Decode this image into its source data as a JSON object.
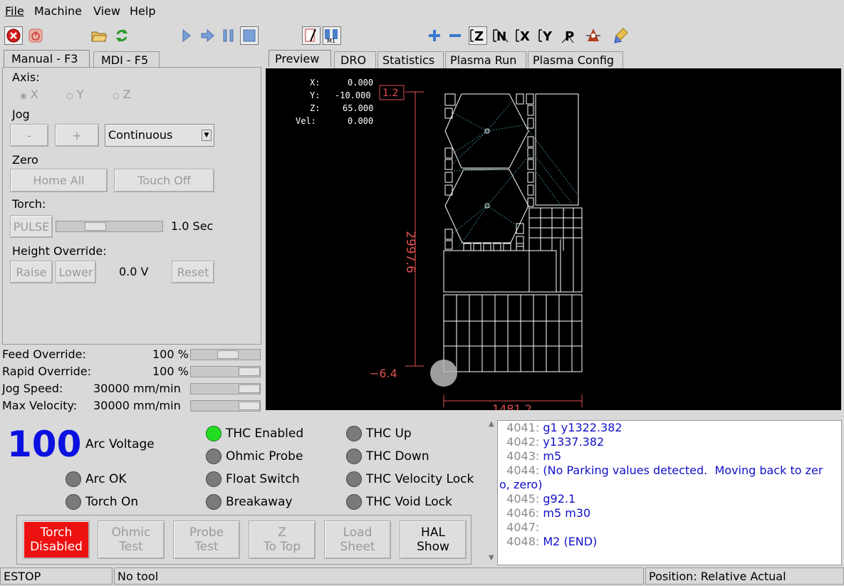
{
  "menu": {
    "file": "File",
    "machine": "Machine",
    "view": "View",
    "help": "Help"
  },
  "toolbar": {
    "estop": "estop-icon",
    "power": "power-icon",
    "open": "open-folder-icon",
    "reload": "reload-icon",
    "run": "run-icon",
    "step": "step-icon",
    "pause": "pause-icon",
    "stop": "stop-icon",
    "plus": "zoom-in-icon",
    "minus": "zoom-out-icon",
    "view_z": "Z",
    "view_z2": "N",
    "view_x": "X",
    "view_y": "Y",
    "view_p": "P"
  },
  "left_tabs": {
    "manual": "Manual - F3",
    "mdi": "MDI - F5"
  },
  "right_tabs": {
    "preview": "Preview",
    "dro": "DRO",
    "statistics": "Statistics",
    "plasma_run": "Plasma Run",
    "plasma_config": "Plasma Config"
  },
  "manual": {
    "axis_label": "Axis:",
    "axis_x": "X",
    "axis_y": "Y",
    "axis_z": "Z",
    "jog_label": "Jog",
    "jog_minus": "-",
    "jog_plus": "+",
    "jog_mode": "Continuous",
    "zero_label": "Zero",
    "home_all": "Home All",
    "touch_off": "Touch Off",
    "torch_label": "Torch:",
    "pulse": "PULSE",
    "pulse_time": "1.0 Sec",
    "height_label": "Height Override:",
    "raise": "Raise",
    "lower": "Lower",
    "height_value": "0.0 V",
    "reset": "Reset"
  },
  "overrides": {
    "feed_label": "Feed Override:",
    "feed_value": "100 %",
    "feed_fraction": 0.55,
    "rapid_label": "Rapid Override:",
    "rapid_value": "100 %",
    "rapid_fraction": 1.0,
    "jog_label": "Jog Speed:",
    "jog_value": "30000 mm/min",
    "jog_fraction": 1.0,
    "maxvel_label": "Max Velocity:",
    "maxvel_value": "30000 mm/min",
    "maxvel_fraction": 1.0
  },
  "preview": {
    "dro_x_label": "X:",
    "dro_x": "0.000",
    "dro_y_label": "Y:",
    "dro_y": "-10.000",
    "dro_z_label": "Z:",
    "dro_z": "65.000",
    "dro_vel_label": "Vel:",
    "dro_vel": "0.000",
    "dim_height": "2997.6",
    "dim_width": "1481.2",
    "dim_origin": "−6.4",
    "dim_top": "1.2",
    "dim_color": "#e05050"
  },
  "plasma": {
    "arc_voltage_value": "100",
    "arc_voltage_label": "Arc Voltage",
    "arc_ok": "Arc OK",
    "torch_on": "Torch On",
    "thc_enabled": "THC Enabled",
    "ohmic_probe": "Ohmic Probe",
    "float_switch": "Float Switch",
    "breakaway": "Breakaway",
    "thc_up": "THC Up",
    "thc_down": "THC Down",
    "thc_velocity_lock": "THC Velocity Lock",
    "thc_void_lock": "THC Void Lock",
    "torch_disabled_1": "Torch",
    "torch_disabled_2": "Disabled",
    "ohmic_test_1": "Ohmic",
    "ohmic_test_2": "Test",
    "probe_test_1": "Probe",
    "probe_test_2": "Test",
    "z_top_1": "Z",
    "z_top_2": "To Top",
    "load_sheet_1": "Load",
    "load_sheet_2": "Sheet",
    "hal_show_1": "HAL",
    "hal_show_2": "Show",
    "accent": "#0a10e0",
    "led_on": "#22dd22",
    "torch_btn_color": "#ee1111"
  },
  "gcode": {
    "lines": [
      {
        "num": "4041:",
        "code": "g1 y1322.382"
      },
      {
        "num": "4042:",
        "code": "y1337.382"
      },
      {
        "num": "4043:",
        "code": "m5"
      },
      {
        "num": "4044:",
        "code": "(No Parking values detected.  Moving back to zer"
      },
      {
        "num": "",
        "code": "o, zero)"
      },
      {
        "num": "4045:",
        "code": "g92.1"
      },
      {
        "num": "4046:",
        "code": "m5 m30"
      },
      {
        "num": "4047:",
        "code": ""
      },
      {
        "num": "4048:",
        "code": "M2 (END)"
      }
    ]
  },
  "status": {
    "estop": "ESTOP",
    "tool": "No tool",
    "position": "Position: Relative Actual"
  }
}
